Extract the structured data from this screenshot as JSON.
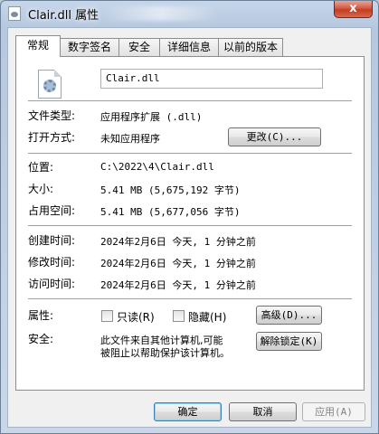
{
  "window": {
    "title": "Clair.dll 属性",
    "close_glyph": "x"
  },
  "tabs": [
    {
      "label": "常规",
      "active": true
    },
    {
      "label": "数字签名",
      "active": false
    },
    {
      "label": "安全",
      "active": false
    },
    {
      "label": "详细信息",
      "active": false
    },
    {
      "label": "以前的版本",
      "active": false
    }
  ],
  "general": {
    "file_icon": "dll-file-icon",
    "file_name": "Clair.dll",
    "file_type_label": "文件类型:",
    "file_type_value": "应用程序扩展 (.dll)",
    "open_with_label": "打开方式:",
    "open_with_value": "未知应用程序",
    "change_button": "更改(C)...",
    "location_label": "位置:",
    "location_value": "C:\\2022\\4\\Clair.dll",
    "size_label": "大小:",
    "size_value": "5.41 MB (5,675,192 字节)",
    "size_on_disk_label": "占用空间:",
    "size_on_disk_value": "5.41 MB (5,677,056 字节)",
    "created_label": "创建时间:",
    "created_value": "2024年2月6日 今天, 1 分钟之前",
    "modified_label": "修改时间:",
    "modified_value": "2024年2月6日 今天, 1 分钟之前",
    "accessed_label": "访问时间:",
    "accessed_value": "2024年2月6日 今天, 1 分钟之前",
    "attributes_label": "属性:",
    "readonly_label": "只读(R)",
    "hidden_label": "隐藏(H)",
    "advanced_button": "高级(D)...",
    "security_label": "安全:",
    "security_text_line1": "此文件来自其他计算机,可能",
    "security_text_line2": "被阻止以帮助保护该计算机。",
    "unblock_button": "解除锁定(K)"
  },
  "footer": {
    "ok": "确定",
    "cancel": "取消",
    "apply": "应用(A)"
  }
}
